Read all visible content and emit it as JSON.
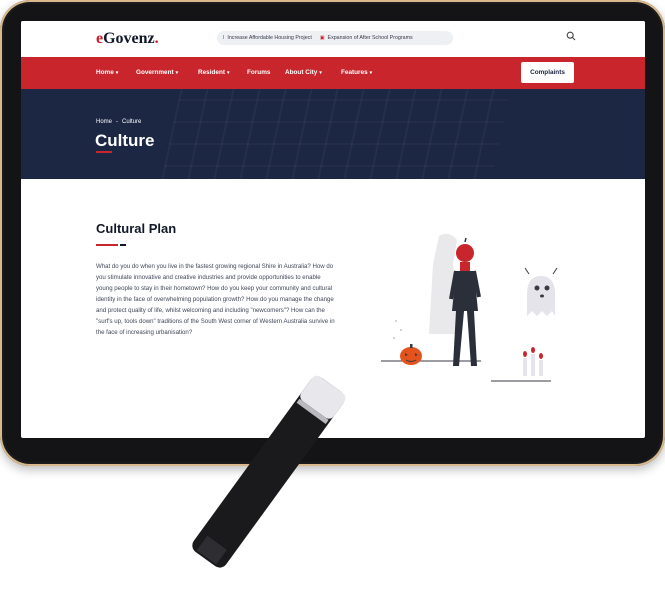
{
  "header": {
    "logo_first": "e",
    "logo_rest": "Govenz",
    "logo_dot": ".",
    "ticker": [
      {
        "mark": "I",
        "text": "Increase Affordable Housing Project"
      },
      {
        "mark": "B",
        "text": "Expansion of After School Programs"
      }
    ],
    "search_icon": "search-icon"
  },
  "nav": {
    "items": [
      {
        "label": "Home",
        "chevron": "⌄"
      },
      {
        "label": "Government",
        "chevron": "⌄"
      },
      {
        "label": "Resident",
        "chevron": "⌄"
      },
      {
        "label": "Forums",
        "chevron": ""
      },
      {
        "label": "About City",
        "chevron": "⌄"
      },
      {
        "label": "Features",
        "chevron": "⌄"
      }
    ],
    "cta": "Complaints",
    "bar_color": "#c8262c"
  },
  "hero": {
    "breadcrumb": [
      "Home",
      "-",
      "Culture"
    ],
    "title": "Culture",
    "bg_color": "#1c2744"
  },
  "content": {
    "title": "Cultural Plan",
    "paragraph": "What do you do when you live in the fastest growing regional Shire in Australia? How do you stimulate innovative and creative industries and provide opportunities to enable young people to stay in their hometown? How do you keep your community and cultural identity in the face of overwhelming population growth? How do you manage the change and protect quality of life, whilst welcoming and including \"newcomers\"? How can the \"surf's up, tools down\" traditions of the South West corner of Western Australia survive in the face of increasing urbanisation?"
  },
  "colors": {
    "accent": "#c8262c",
    "navy": "#1c2744",
    "frame_gold": "#d9b98c"
  }
}
